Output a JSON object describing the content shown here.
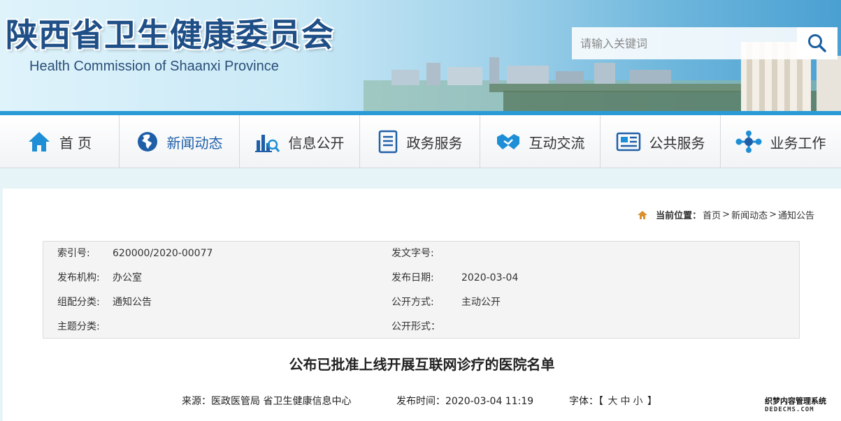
{
  "header": {
    "title_cn": "陕西省卫生健康委员会",
    "title_en": "Health Commission of Shaanxi Province",
    "search_placeholder": "请输入关键词"
  },
  "nav": {
    "items": [
      {
        "label": "首 页",
        "icon": "home-icon"
      },
      {
        "label": "新闻动态",
        "icon": "globe-icon"
      },
      {
        "label": "信息公开",
        "icon": "chart-search-icon"
      },
      {
        "label": "政务服务",
        "icon": "document-icon"
      },
      {
        "label": "互动交流",
        "icon": "handshake-icon"
      },
      {
        "label": "公共服务",
        "icon": "newspaper-icon"
      },
      {
        "label": "业务工作",
        "icon": "network-icon"
      }
    ],
    "active_color": "#1f5fa8"
  },
  "breadcrumb": {
    "prefix": "当前位置：",
    "home": "首页",
    "level1": "新闻动态",
    "level2": "通知公告",
    "sep": ">"
  },
  "meta": {
    "index_label": "索引号:",
    "index_value": "620000/2020-00077",
    "doc_no_label": "发文字号:",
    "doc_no_value": "",
    "org_label": "发布机构:",
    "org_value": "办公室",
    "date_label": "发布日期:",
    "date_value": "2020-03-04",
    "category_label": "组配分类:",
    "category_value": "通知公告",
    "open_label": "公开方式:",
    "open_value": "主动公开",
    "topic_label": "主题分类:",
    "topic_value": "",
    "form_label": "公开形式：",
    "form_value": ""
  },
  "article": {
    "title": "公布已批准上线开展互联网诊疗的医院名单",
    "source": "来源：医政医管局 省卫生健康信息中心",
    "publish_time": "发布时间：2020-03-04 11:19",
    "font_label": "字体：",
    "bracket_open": "【",
    "size_large": "大",
    "size_medium": "中",
    "size_small": "小",
    "bracket_close": "】"
  },
  "watermark": {
    "line1": "织梦内容管理系统",
    "line2": "DEDECMS.COM"
  }
}
